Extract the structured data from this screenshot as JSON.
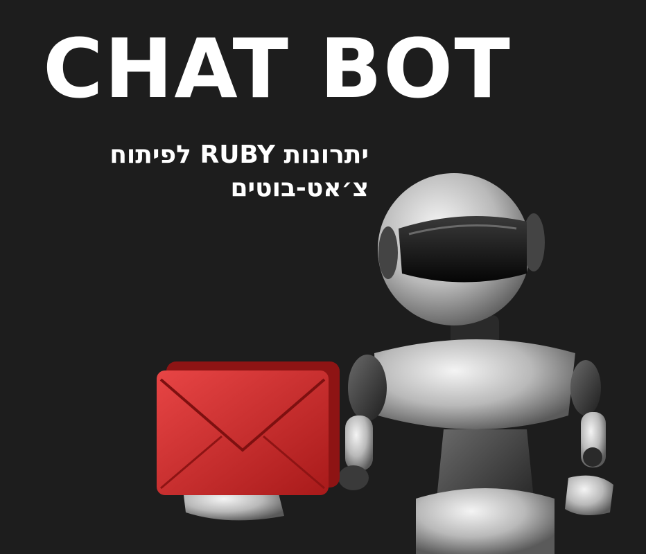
{
  "headline": "CHAT BOT",
  "subtitle": {
    "line1": "יתרונות RUBY לפיתוח",
    "line2": "צ׳אט-בוטים"
  },
  "illustration": {
    "robot": "robot",
    "envelope": "envelope-icon"
  },
  "colors": {
    "background": "#1d1d1d",
    "text": "#ffffff",
    "envelope": "#d42a2a"
  }
}
